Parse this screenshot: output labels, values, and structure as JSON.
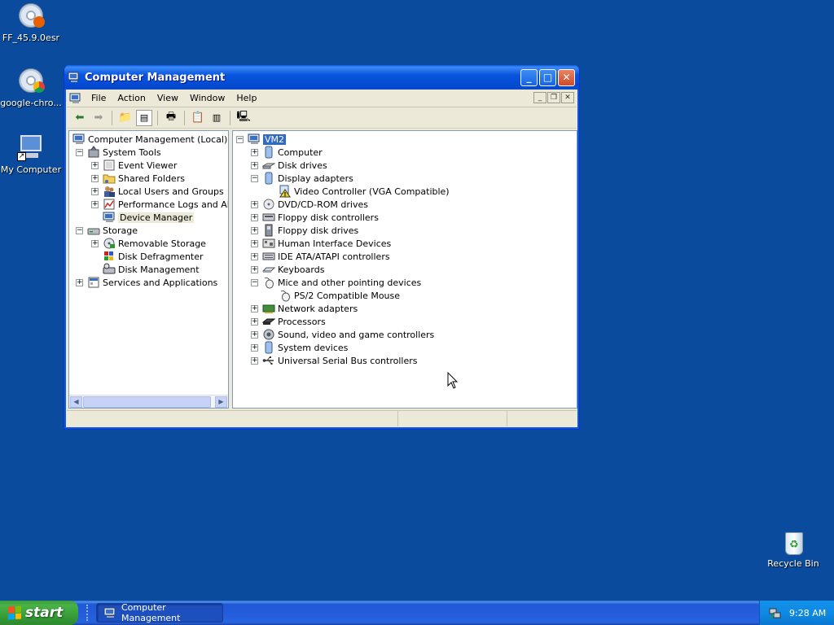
{
  "desktop": {
    "icons": [
      {
        "label": "FF_45.9.0esr"
      },
      {
        "label": "google-chro..."
      },
      {
        "label": "My Computer"
      },
      {
        "label": "Recycle Bin"
      }
    ]
  },
  "window": {
    "title": "Computer Management",
    "menu": [
      "File",
      "Action",
      "View",
      "Window",
      "Help"
    ]
  },
  "left_tree": {
    "root": "Computer Management (Local)",
    "items": [
      "System Tools",
      "Event Viewer",
      "Shared Folders",
      "Local Users and Groups",
      "Performance Logs and Alerts",
      "Device Manager",
      "Storage",
      "Removable Storage",
      "Disk Defragmenter",
      "Disk Management",
      "Services and Applications"
    ]
  },
  "device_tree": {
    "root": "VM2",
    "items": [
      "Computer",
      "Disk drives",
      "Display adapters",
      "Video Controller (VGA Compatible)",
      "DVD/CD-ROM drives",
      "Floppy disk controllers",
      "Floppy disk drives",
      "Human Interface Devices",
      "IDE ATA/ATAPI controllers",
      "Keyboards",
      "Mice and other pointing devices",
      "PS/2 Compatible Mouse",
      "Network adapters",
      "Processors",
      "Sound, video and game controllers",
      "System devices",
      "Universal Serial Bus controllers"
    ]
  },
  "taskbar": {
    "start_label": "start",
    "task_label": "Computer Management",
    "clock": "9:28 AM"
  }
}
